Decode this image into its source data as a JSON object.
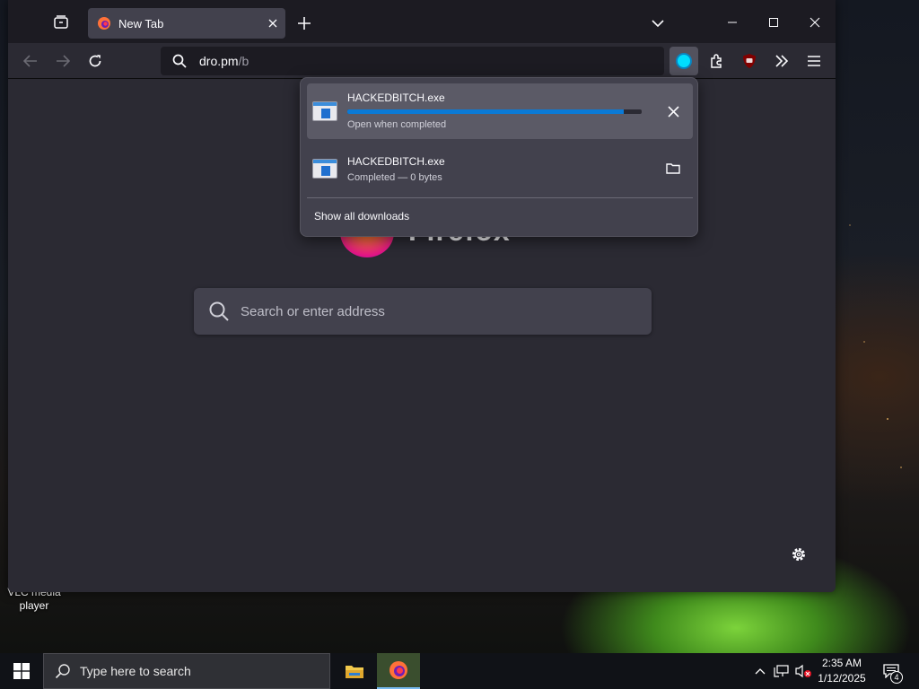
{
  "desktop": {
    "icon_label": "VLC media player"
  },
  "browser": {
    "tab": {
      "title": "New Tab"
    },
    "url": {
      "host": "dro.pm",
      "path": "/b"
    },
    "brand_word": "Firefox",
    "search_placeholder": "Search or enter address",
    "accent_color": "#00ddff"
  },
  "downloads_panel": {
    "items": [
      {
        "filename": "HACKEDBITCH.exe",
        "status": "Open when completed",
        "progress_percent": 94,
        "action_icon": "close-icon"
      },
      {
        "filename": "HACKEDBITCH.exe",
        "status": "Completed — 0 bytes",
        "action_icon": "folder-icon"
      }
    ],
    "show_all_label": "Show all downloads"
  },
  "taskbar": {
    "search_placeholder": "Type here to search",
    "clock": {
      "time": "2:35 AM",
      "date": "1/12/2025"
    },
    "notification_count": "4"
  }
}
